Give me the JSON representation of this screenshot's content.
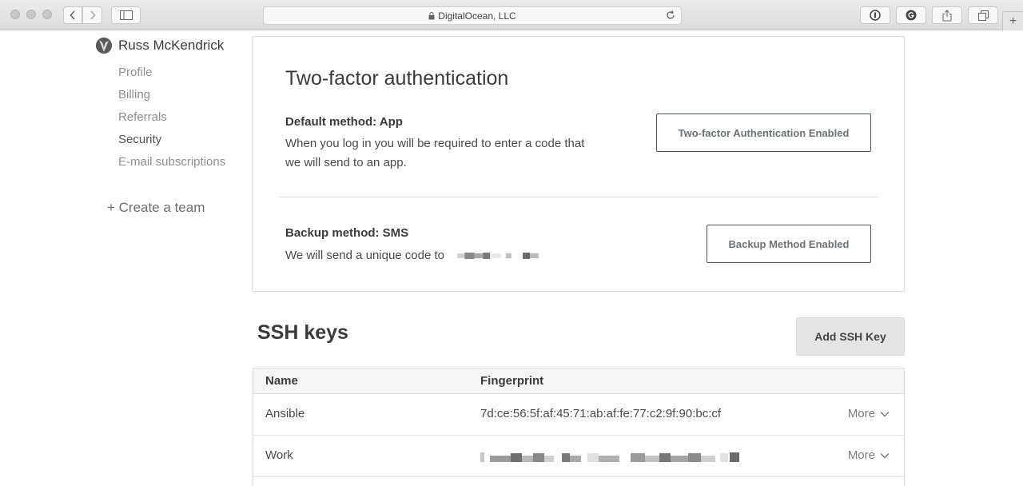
{
  "browser": {
    "address": "DigitalOcean, LLC",
    "new_tab": "+"
  },
  "sidebar": {
    "user_name": "Russ McKendrick",
    "items": [
      {
        "label": "Profile",
        "active": false
      },
      {
        "label": "Billing",
        "active": false
      },
      {
        "label": "Referrals",
        "active": false
      },
      {
        "label": "Security",
        "active": true
      },
      {
        "label": "E-mail subscriptions",
        "active": false
      }
    ],
    "create_team": "+ Create a team"
  },
  "two_factor": {
    "title": "Two-factor authentication",
    "default_method": {
      "heading": "Default method: App",
      "description_line1": "When you log in you will be required to enter a code that",
      "description_line2": "we will send to an app.",
      "button": "Two-factor Authentication Enabled"
    },
    "backup_method": {
      "heading": "Backup method: SMS",
      "description": "We will send a unique code to",
      "button": "Backup Method Enabled"
    }
  },
  "ssh_keys": {
    "title": "SSH keys",
    "add_button": "Add SSH Key",
    "columns": [
      "Name",
      "Fingerprint"
    ],
    "rows": [
      {
        "name": "Ansible",
        "fingerprint": "7d:ce:56:5f:af:45:71:ab:af:fe:77:c2:9f:90:bc:cf",
        "action": "More"
      },
      {
        "name": "Work",
        "fingerprint": "",
        "action": "More"
      }
    ]
  }
}
